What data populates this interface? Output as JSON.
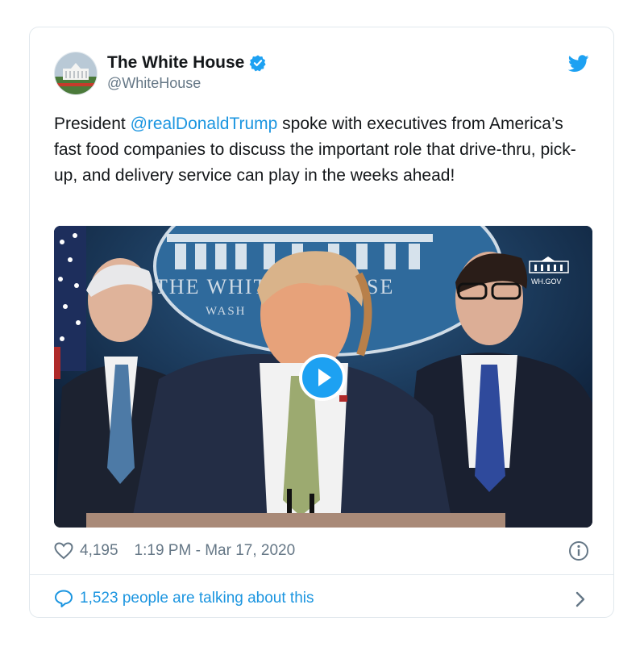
{
  "author": {
    "name": "The White House",
    "handle": "@WhiteHouse"
  },
  "tweet": {
    "text_before": "President ",
    "mention": "@realDonaldTrump",
    "text_after": " spoke with executives from America’s fast food companies to discuss the important role that drive-thru, pick-up, and delivery service can play in the weeks ahead!"
  },
  "media": {
    "podium_seal_text_1": "THE WHIT",
    "podium_seal_text_2": "SE",
    "podium_seal_subtext": "WASH",
    "watermark": "WH.GOV"
  },
  "stats": {
    "likes": "4,195",
    "timestamp": "1:19 PM - Mar 17, 2020"
  },
  "conversation": {
    "label": "1,523 people are talking about this"
  },
  "icons": {
    "verified": "verified-badge-icon",
    "bird": "twitter-bird-icon",
    "heart": "heart-icon",
    "info": "info-icon",
    "reply": "speech-bubble-icon",
    "chevron": "chevron-right-icon",
    "play": "play-icon"
  },
  "colors": {
    "accent": "#1da1f2",
    "link": "#1b95e0",
    "muted": "#657786",
    "border": "#e1e8ed",
    "text": "#14171a"
  }
}
